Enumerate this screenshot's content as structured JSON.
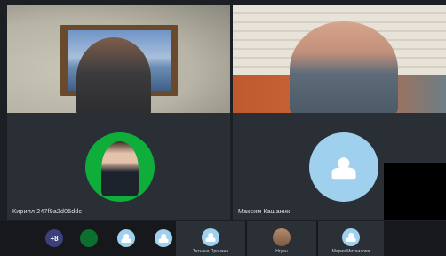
{
  "tiles": {
    "cam_left": {
      "label": ""
    },
    "cam_right": {
      "label": ""
    },
    "profile_left": {
      "label": "Кирилл 247f9a2d05ddc"
    },
    "profile_right": {
      "label": "Максим Кашаник"
    }
  },
  "bottom_bar": {
    "more_count": "+8",
    "participants": [
      {
        "name": ""
      },
      {
        "name": ""
      },
      {
        "name": ""
      },
      {
        "name": "Татьяна Пронина"
      },
      {
        "name": "Нгуен"
      },
      {
        "name": "Мария Михаилова"
      }
    ]
  },
  "colors": {
    "tile_bg": "#2a2e35",
    "avatar_blue": "#9fd0ee",
    "green_ring": "#0fae3b",
    "strip_bg": "#2b2f36"
  }
}
